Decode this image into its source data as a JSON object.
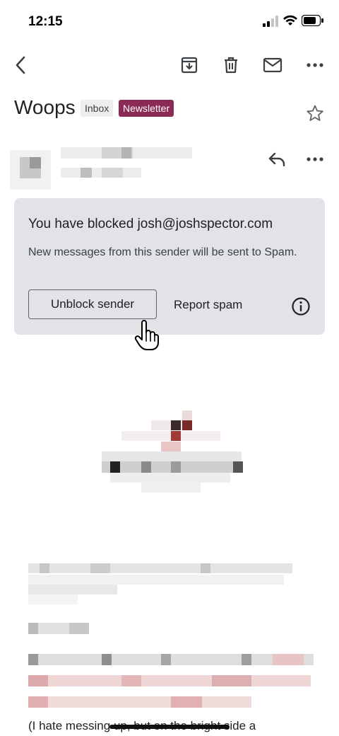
{
  "status_bar": {
    "time": "12:15"
  },
  "toolbar": {
    "back_icon": "chevron-left-icon",
    "archive_icon": "archive-icon",
    "delete_icon": "trash-icon",
    "mark_unread_icon": "mail-icon",
    "more_icon": "more-horizontal-icon"
  },
  "email": {
    "subject": "Woops",
    "labels": [
      "Inbox",
      "Newsletter"
    ],
    "label_colors": {
      "inbox_bg": "#eeeeee",
      "newsletter_bg": "#8a2a55"
    }
  },
  "blocked_card": {
    "title": "You have blocked josh@joshspector.com",
    "message": "New messages from this sender will be sent to Spam.",
    "unblock_label": "Unblock sender",
    "report_label": "Report spam",
    "info_icon": "info-icon"
  },
  "body": {
    "visible_text": "(I hate messing up, but on the bright side a"
  }
}
